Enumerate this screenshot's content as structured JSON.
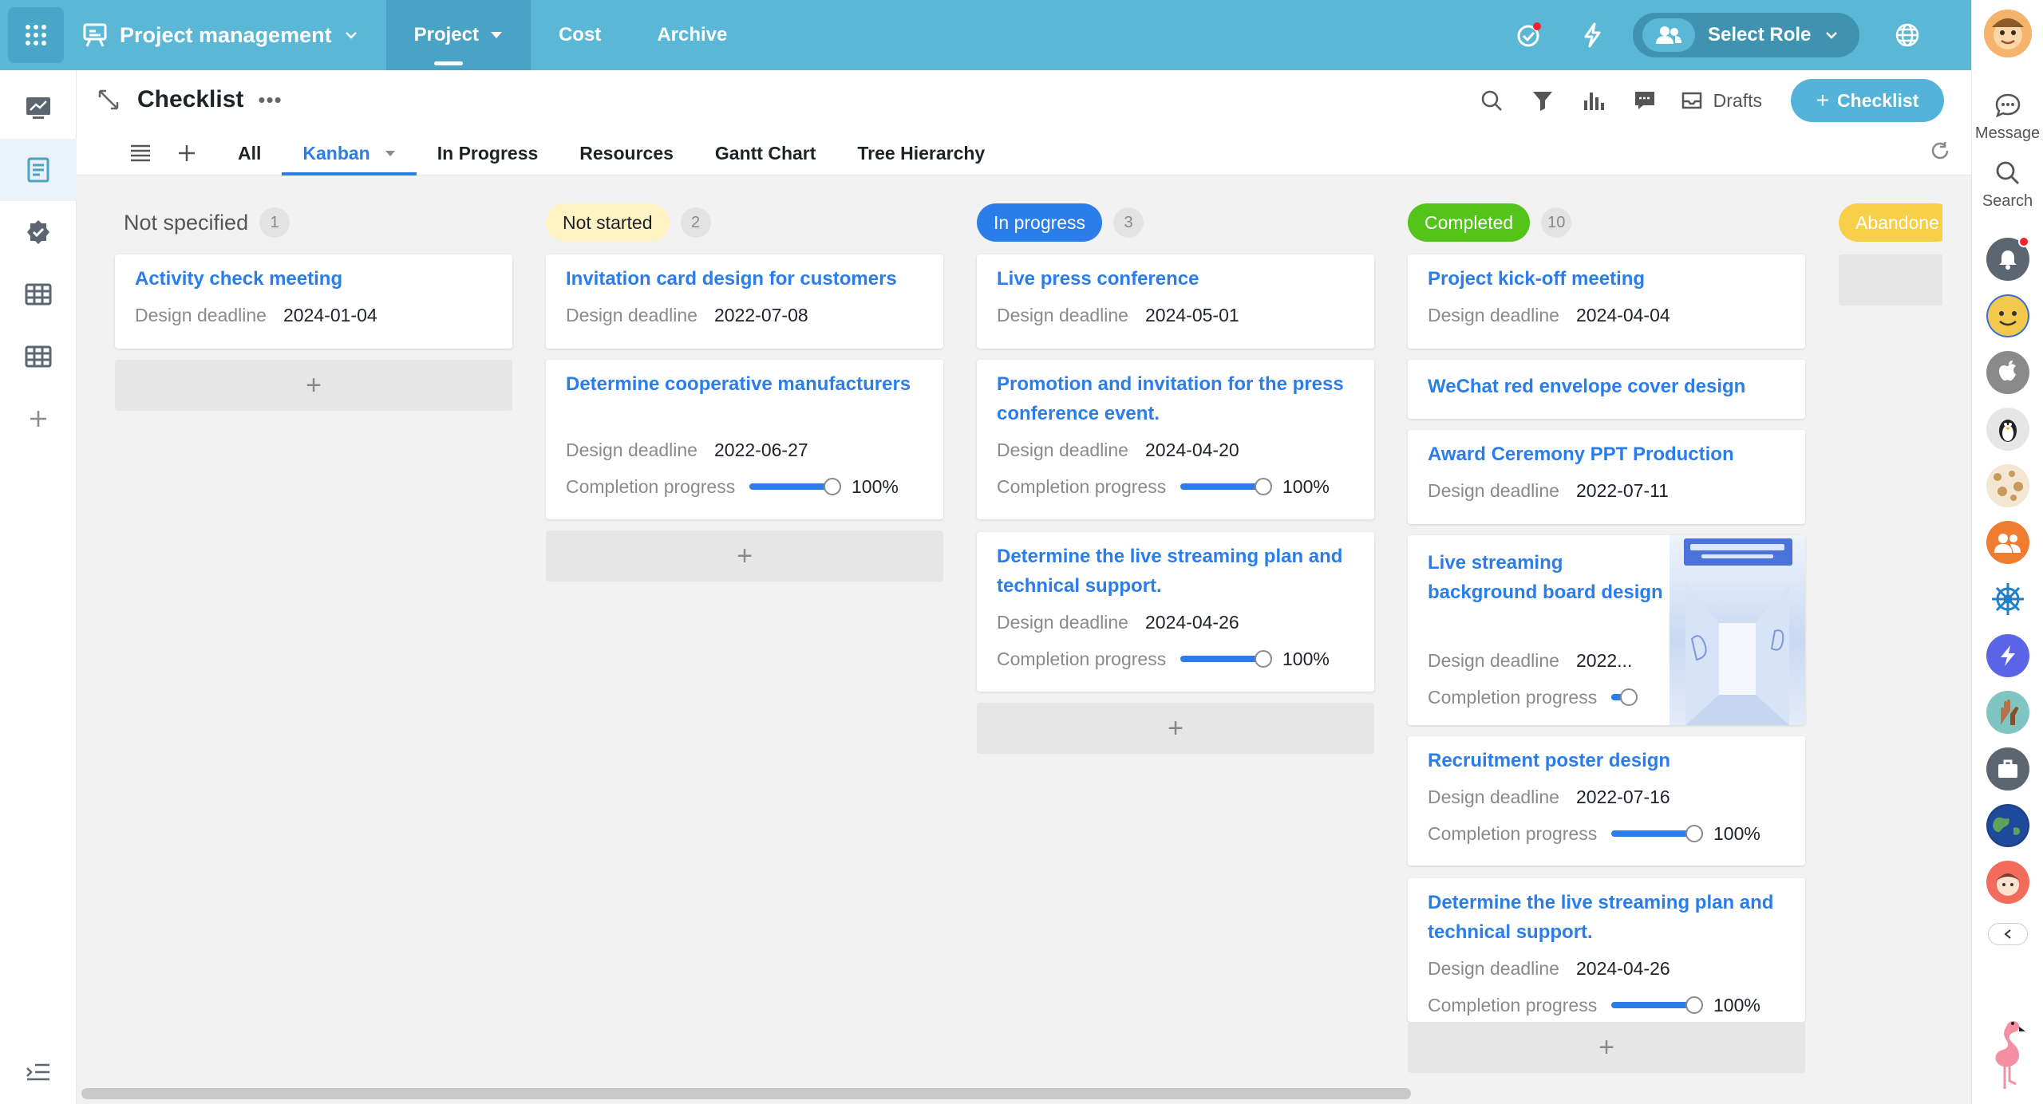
{
  "topbar": {
    "app_title": "Project management",
    "nav": [
      {
        "label": "Project",
        "active": true
      },
      {
        "label": "Cost",
        "active": false
      },
      {
        "label": "Archive",
        "active": false
      }
    ],
    "role_button": "Select Role",
    "accent": "#5ab7d6"
  },
  "right_rail": {
    "message_label": "Message",
    "search_label": "Search"
  },
  "header": {
    "title": "Checklist",
    "drafts_label": "Drafts",
    "new_button": "Checklist",
    "tabs": [
      "All",
      "Kanban",
      "In Progress",
      "Resources",
      "Gantt Chart",
      "Tree Hierarchy"
    ],
    "active_tab": "Kanban"
  },
  "labels": {
    "design_deadline": "Design deadline",
    "completion_progress": "Completion progress"
  },
  "columns": [
    {
      "status": "Not specified",
      "count": "1",
      "color": "",
      "cards": [
        {
          "title": "Activity check meeting",
          "deadline": "2024-01-04"
        }
      ]
    },
    {
      "status": "Not started",
      "count": "2",
      "color": "#fff3c4",
      "cards": [
        {
          "title": "Invitation card design for customers",
          "deadline": "2022-07-08"
        },
        {
          "title": "Determine cooperative manufacturers",
          "deadline": "2022-06-27",
          "progress": "100%"
        }
      ]
    },
    {
      "status": "In progress",
      "count": "3",
      "color": "#2b7de9",
      "cards": [
        {
          "title": "Live press conference",
          "deadline": "2024-05-01"
        },
        {
          "title": "Promotion and invitation for the press conference event.",
          "deadline": "2024-04-20",
          "progress": "100%"
        },
        {
          "title": "Determine the live streaming plan and technical support.",
          "deadline": "2024-04-26",
          "progress": "100%"
        }
      ]
    },
    {
      "status": "Completed",
      "count": "10",
      "color": "#52c41a",
      "cards": [
        {
          "title": "Project kick-off meeting",
          "deadline": "2024-04-04"
        },
        {
          "title": "WeChat red envelope cover design"
        },
        {
          "title": "Award Ceremony PPT Production",
          "deadline": "2022-07-11"
        },
        {
          "title": "Live streaming background board design",
          "deadline": "2022...",
          "progress_fraction": 0.2
        },
        {
          "title": "Recruitment poster design",
          "deadline": "2022-07-16",
          "progress": "100%"
        },
        {
          "title": "Determine the live streaming plan and technical support.",
          "deadline": "2024-04-26",
          "progress": "100%"
        }
      ]
    },
    {
      "status": "Abandone",
      "color": "#f7cf48",
      "cards": []
    }
  ]
}
